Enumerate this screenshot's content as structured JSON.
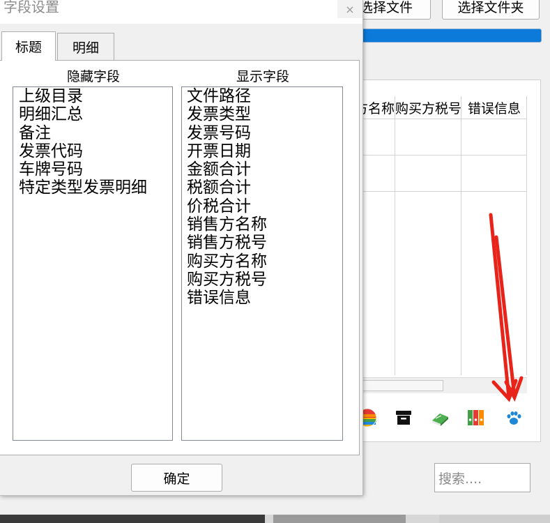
{
  "main": {
    "select_file_label": "选择文件",
    "select_folder_label": "选择文件夹",
    "progress_percent": 100,
    "table_headers": [
      "方名称",
      "购买方税号",
      "错误信息"
    ],
    "search_placeholder": "搜索....",
    "toolbar_icons": [
      "color-wheel-icon",
      "archive-box-icon",
      "book-icon",
      "binders-icon",
      "paw-print-icon"
    ]
  },
  "dialog": {
    "title": "字段设置",
    "close_glyph": "×",
    "tabs": [
      {
        "label": "标题",
        "active": true
      },
      {
        "label": "明细",
        "active": false
      }
    ],
    "hidden_fields_title": "隐藏字段",
    "shown_fields_title": "显示字段",
    "hidden_fields": [
      "上级目录",
      "明细汇总",
      "备注",
      "发票代码",
      "车牌号码",
      "特定类型发票明细"
    ],
    "shown_fields": [
      "文件路径",
      "发票类型",
      "发票号码",
      "开票日期",
      "金额合计",
      "税额合计",
      "价税合计",
      "销售方名称",
      "销售方税号",
      "购买方名称",
      "购买方税号",
      "错误信息"
    ],
    "ok_label": "确定"
  },
  "colors": {
    "progress": "#0b7ad9",
    "annotation_arrow": "#e8231a",
    "paw_icon": "#1e88d6"
  }
}
